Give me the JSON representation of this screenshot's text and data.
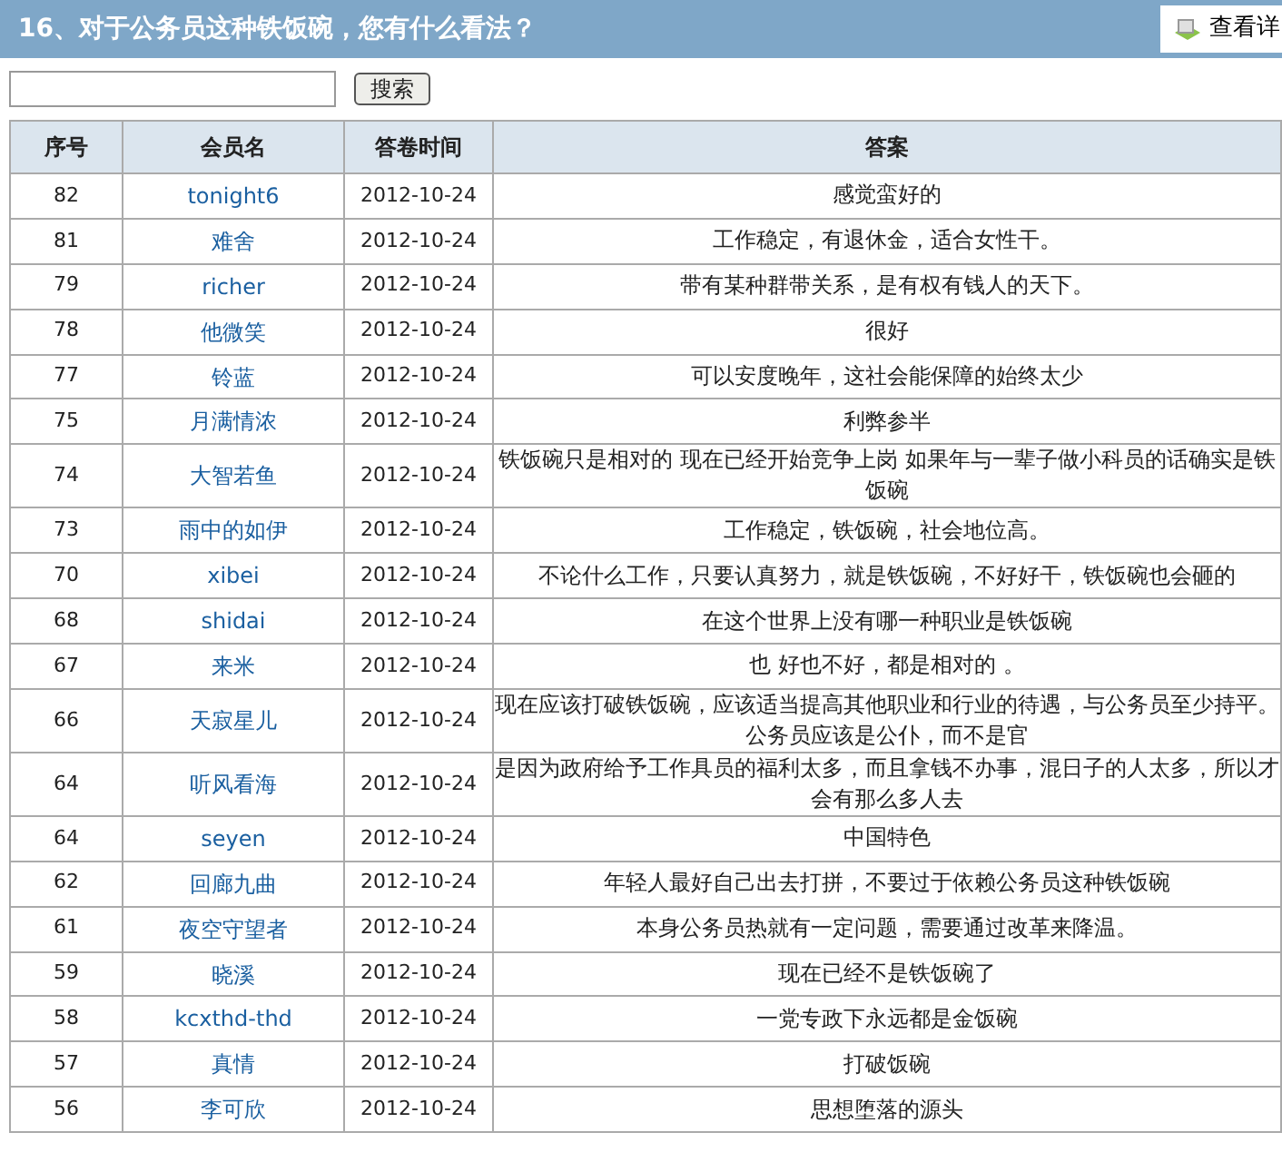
{
  "header": {
    "title": "16、对于公务员这种铁饭碗，您有什么看法？",
    "view_button": "查看详"
  },
  "search": {
    "button": "搜索"
  },
  "table": {
    "columns": [
      "序号",
      "会员名",
      "答卷时间",
      "答案"
    ],
    "rows": [
      {
        "no": "82",
        "member": "tonight6",
        "time": "2012-10-24",
        "answer": "感觉蛮好的"
      },
      {
        "no": "81",
        "member": "难舍",
        "time": "2012-10-24",
        "answer": "工作稳定，有退休金，适合女性干。"
      },
      {
        "no": "79",
        "member": "richer",
        "time": "2012-10-24",
        "answer": "带有某种群带关系，是有权有钱人的天下。"
      },
      {
        "no": "78",
        "member": "他微笑",
        "time": "2012-10-24",
        "answer": "很好"
      },
      {
        "no": "77",
        "member": "铃蓝",
        "time": "2012-10-24",
        "answer": "可以安度晚年，这社会能保障的始终太少"
      },
      {
        "no": "75",
        "member": "月满情浓",
        "time": "2012-10-24",
        "answer": "利弊参半"
      },
      {
        "no": "74",
        "member": "大智若鱼",
        "time": "2012-10-24",
        "answer": "铁饭碗只是相对的 现在已经开始竞争上岗 如果年与一辈子做小科员的话确实是铁饭碗"
      },
      {
        "no": "73",
        "member": "雨中的如伊",
        "time": "2012-10-24",
        "answer": "工作稳定，铁饭碗，社会地位高。"
      },
      {
        "no": "70",
        "member": "xibei",
        "time": "2012-10-24",
        "answer": "不论什么工作，只要认真努力，就是铁饭碗，不好好干，铁饭碗也会砸的"
      },
      {
        "no": "68",
        "member": "shidai",
        "time": "2012-10-24",
        "answer": "在这个世界上没有哪一种职业是铁饭碗"
      },
      {
        "no": "67",
        "member": "来米",
        "time": "2012-10-24",
        "answer": "也 好也不好，都是相对的 。"
      },
      {
        "no": "66",
        "member": "天寂星儿",
        "time": "2012-10-24",
        "answer": "现在应该打破铁饭碗，应该适当提高其他职业和行业的待遇，与公务员至少持平。公务员应该是公仆，而不是官"
      },
      {
        "no": "64",
        "member": "听风看海",
        "time": "2012-10-24",
        "answer": "是因为政府给予工作具员的福利太多，而且拿钱不办事，混日子的人太多，所以才会有那么多人去"
      },
      {
        "no": "64",
        "member": "seyen",
        "time": "2012-10-24",
        "answer": "中国特色"
      },
      {
        "no": "62",
        "member": "回廊九曲",
        "time": "2012-10-24",
        "answer": "年轻人最好自己出去打拼，不要过于依赖公务员这种铁饭碗"
      },
      {
        "no": "61",
        "member": "夜空守望者",
        "time": "2012-10-24",
        "answer": "本身公务员热就有一定问题，需要通过改革来降温。"
      },
      {
        "no": "59",
        "member": "晓溪",
        "time": "2012-10-24",
        "answer": "现在已经不是铁饭碗了"
      },
      {
        "no": "58",
        "member": "kcxthd-thd",
        "time": "2012-10-24",
        "answer": "一党专政下永远都是金饭碗"
      },
      {
        "no": "57",
        "member": "真情",
        "time": "2012-10-24",
        "answer": "打破饭碗"
      },
      {
        "no": "56",
        "member": "李可欣",
        "time": "2012-10-24",
        "answer": "思想堕落的源头"
      }
    ]
  }
}
